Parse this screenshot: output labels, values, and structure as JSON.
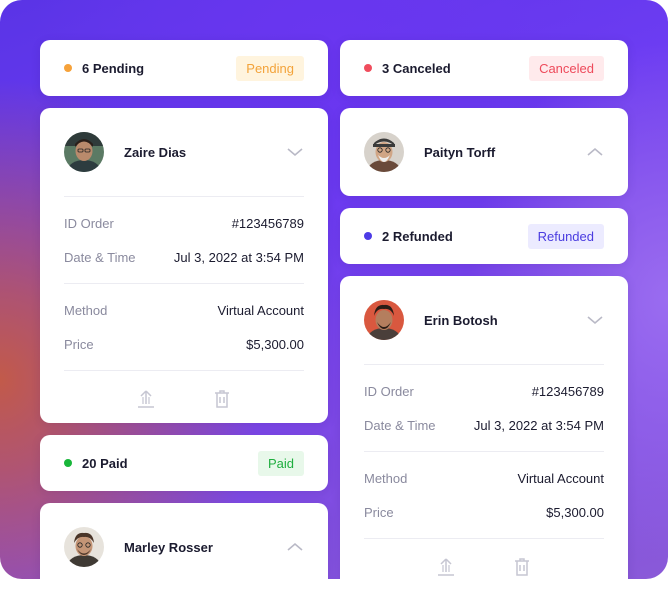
{
  "left": {
    "pending": {
      "label": "6 Pending",
      "badge": "Pending",
      "dot_color": "#f6a23a",
      "badge_bg": "#fff4de",
      "badge_color": "#f3a33a"
    },
    "order1": {
      "name": "Zaire Dias",
      "id_label": "ID Order",
      "id_value": "#123456789",
      "date_label": "Date & Time",
      "date_value": "Jul 3, 2022 at 3:54 PM",
      "method_label": "Method",
      "method_value": "Virtual Account",
      "price_label": "Price",
      "price_value": "$5,300.00"
    },
    "paid": {
      "label": "20 Paid",
      "badge": "Paid",
      "dot_color": "#18b63a",
      "badge_bg": "#e8f8ea",
      "badge_color": "#1fae3f"
    },
    "order2": {
      "name": "Marley Rosser"
    }
  },
  "right": {
    "canceled": {
      "label": "3 Canceled",
      "badge": "Canceled",
      "dot_color": "#f04d5d",
      "badge_bg": "#ffeaec",
      "badge_color": "#ee4a5b"
    },
    "order1": {
      "name": "Paityn Torff"
    },
    "refunded": {
      "label": "2 Refunded",
      "badge": "Refunded",
      "dot_color": "#4d3be6",
      "badge_bg": "#ecebff",
      "badge_color": "#4a3ce0"
    },
    "order2": {
      "name": "Erin Botosh",
      "id_label": "ID Order",
      "id_value": "#123456789",
      "date_label": "Date & Time",
      "date_value": "Jul 3, 2022 at 3:54 PM",
      "method_label": "Method",
      "method_value": "Virtual Account",
      "price_label": "Price",
      "price_value": "$5,300.00"
    }
  }
}
